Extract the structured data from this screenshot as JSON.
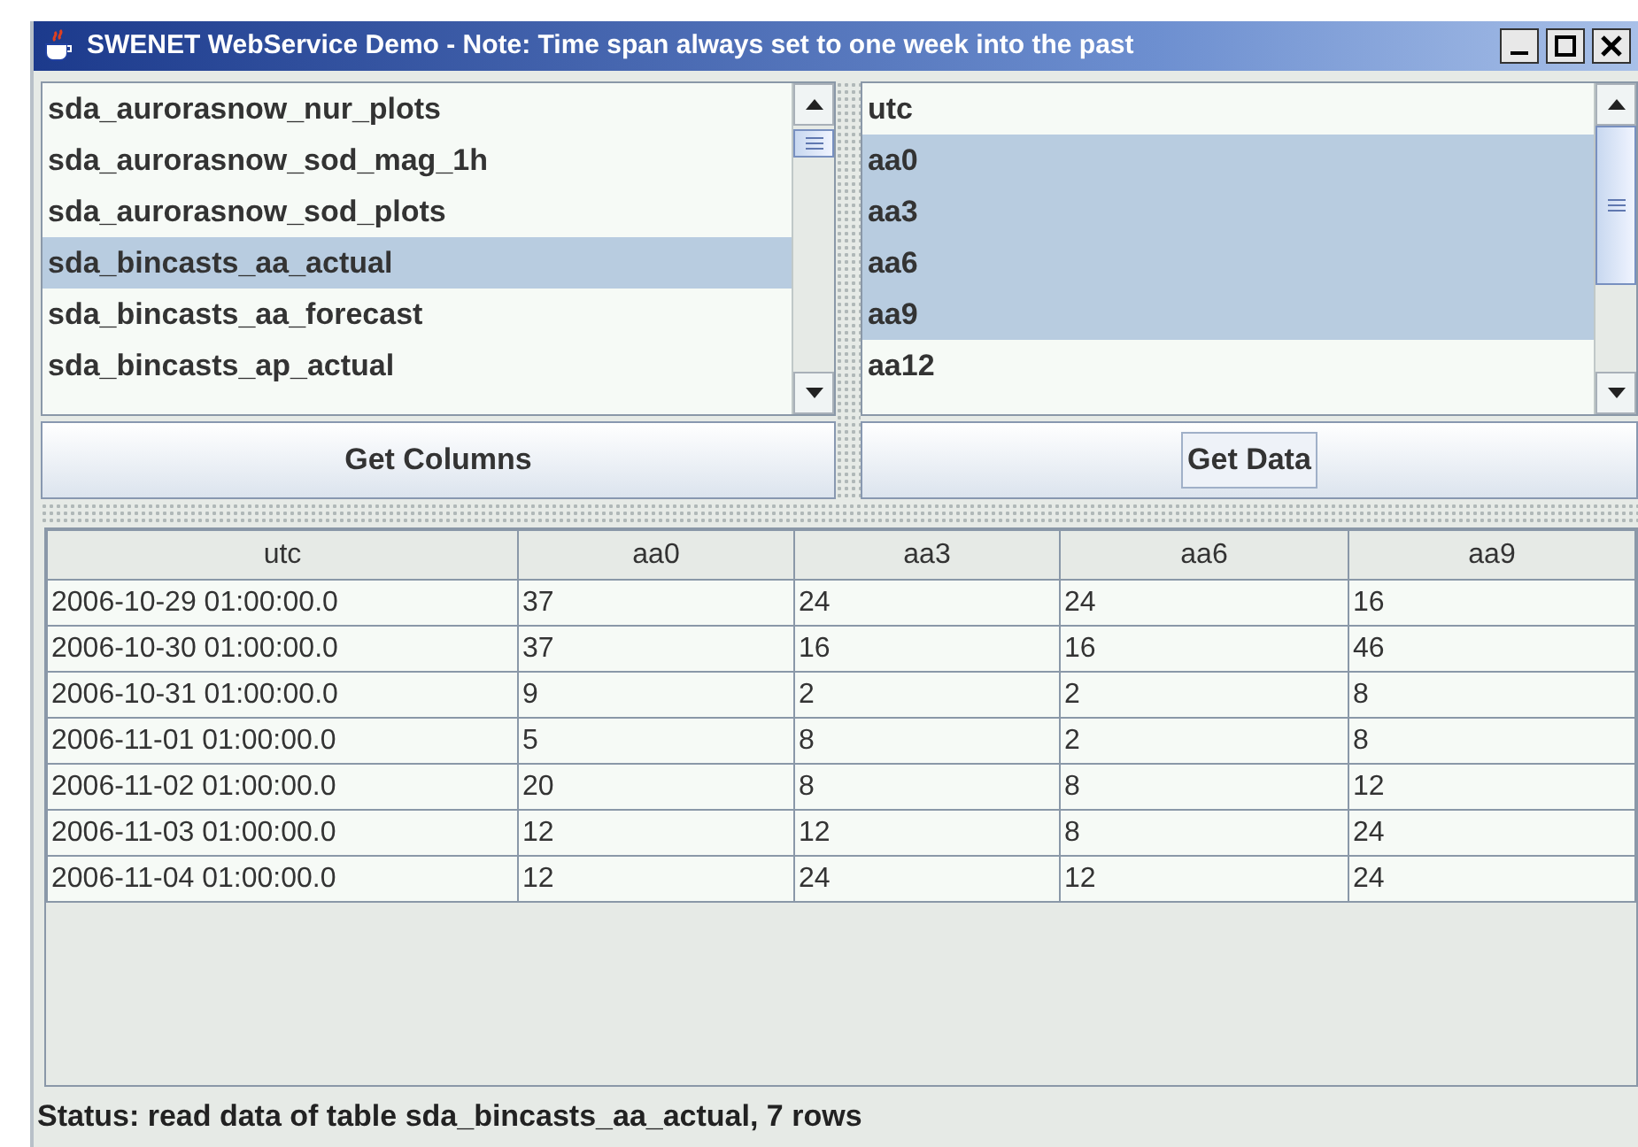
{
  "window": {
    "title": "SWENET WebService Demo - Note: Time span always set to one week into the past"
  },
  "tables_list": {
    "items": [
      {
        "label": "sda_aurorasnow_nur_plots",
        "selected": false
      },
      {
        "label": "sda_aurorasnow_sod_mag_1h",
        "selected": false
      },
      {
        "label": "sda_aurorasnow_sod_plots",
        "selected": false
      },
      {
        "label": "sda_bincasts_aa_actual",
        "selected": true
      },
      {
        "label": "sda_bincasts_aa_forecast",
        "selected": false
      },
      {
        "label": "sda_bincasts_ap_actual",
        "selected": false
      }
    ]
  },
  "columns_list": {
    "items": [
      {
        "label": "utc",
        "selected": false
      },
      {
        "label": "aa0",
        "selected": true
      },
      {
        "label": "aa3",
        "selected": true
      },
      {
        "label": "aa6",
        "selected": true
      },
      {
        "label": "aa9",
        "selected": true
      },
      {
        "label": "aa12",
        "selected": false
      }
    ]
  },
  "buttons": [
    {
      "label": "Get Columns",
      "focused": false
    },
    {
      "label": "Get Data",
      "focused": true
    }
  ],
  "table": {
    "columns": [
      "utc",
      "aa0",
      "aa3",
      "aa6",
      "aa9"
    ],
    "rows": [
      [
        "2006-10-29 01:00:00.0",
        "37",
        "24",
        "24",
        "16"
      ],
      [
        "2006-10-30 01:00:00.0",
        "37",
        "16",
        "16",
        "46"
      ],
      [
        "2006-10-31 01:00:00.0",
        "9",
        "2",
        "2",
        "8"
      ],
      [
        "2006-11-01 01:00:00.0",
        "5",
        "8",
        "2",
        "8"
      ],
      [
        "2006-11-02 01:00:00.0",
        "20",
        "8",
        "8",
        "12"
      ],
      [
        "2006-11-03 01:00:00.0",
        "12",
        "12",
        "8",
        "24"
      ],
      [
        "2006-11-04 01:00:00.0",
        "12",
        "24",
        "12",
        "24"
      ]
    ]
  },
  "status_bar": "Status: read data of table sda_bincasts_aa_actual, 7 rows"
}
